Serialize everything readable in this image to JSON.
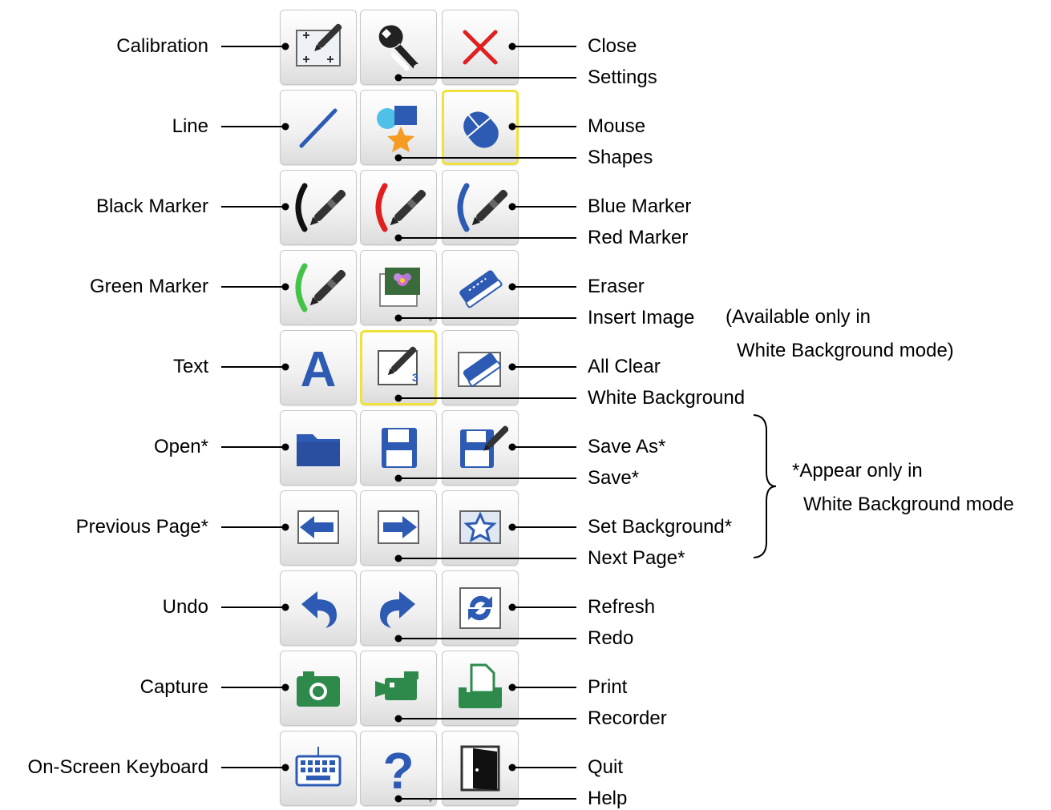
{
  "left_labels": [
    "Calibration",
    "Line",
    "Black Marker",
    "Green Marker",
    "Text",
    "Open*",
    "Previous Page*",
    "Undo",
    "Capture",
    "On-Screen Keyboard"
  ],
  "right_labels": [
    [
      "Close",
      "Settings"
    ],
    [
      "Mouse",
      "Shapes"
    ],
    [
      "Blue Marker",
      "Red Marker"
    ],
    [
      "Eraser",
      "Insert Image"
    ],
    [
      "All Clear",
      "White Background"
    ],
    [
      "Save As*",
      "Save*"
    ],
    [
      "Set Background*",
      "Next Page*"
    ],
    [
      "Refresh",
      "Redo"
    ],
    [
      "Print",
      "Recorder"
    ],
    [
      "Quit",
      "Help"
    ]
  ],
  "grid": [
    [
      {
        "icon": "calibration-icon"
      },
      {
        "icon": "wrench-icon"
      },
      {
        "icon": "close-x-icon"
      }
    ],
    [
      {
        "icon": "line-icon"
      },
      {
        "icon": "shapes-icon"
      },
      {
        "icon": "mouse-icon",
        "selected": true
      }
    ],
    [
      {
        "icon": "black-marker-icon"
      },
      {
        "icon": "red-marker-icon"
      },
      {
        "icon": "blue-marker-icon"
      }
    ],
    [
      {
        "icon": "green-marker-icon"
      },
      {
        "icon": "insert-image-icon",
        "dropdown": true
      },
      {
        "icon": "eraser-icon"
      }
    ],
    [
      {
        "icon": "text-a-icon"
      },
      {
        "icon": "white-background-icon",
        "selected": true,
        "badge": "3"
      },
      {
        "icon": "all-clear-icon"
      }
    ],
    [
      {
        "icon": "folder-icon"
      },
      {
        "icon": "floppy-save-icon"
      },
      {
        "icon": "floppy-save-as-icon"
      }
    ],
    [
      {
        "icon": "arrow-left-icon"
      },
      {
        "icon": "arrow-right-icon"
      },
      {
        "icon": "star-background-icon"
      }
    ],
    [
      {
        "icon": "undo-icon"
      },
      {
        "icon": "redo-icon"
      },
      {
        "icon": "refresh-icon"
      }
    ],
    [
      {
        "icon": "camera-icon"
      },
      {
        "icon": "video-camera-icon"
      },
      {
        "icon": "print-icon"
      }
    ],
    [
      {
        "icon": "keyboard-icon"
      },
      {
        "icon": "question-mark-icon",
        "dropdown": true
      },
      {
        "icon": "door-quit-icon"
      }
    ]
  ],
  "notes": {
    "insert_image_line1": "(Available only in",
    "insert_image_line2": "White Background mode)",
    "white_mode_line1": "*Appear only in",
    "white_mode_line2": "White Background mode"
  },
  "colors": {
    "blue": "#2d5bb4",
    "red": "#e02020",
    "black": "#111111",
    "green": "#2e8a4a",
    "green_marker": "#45c248",
    "orange": "#f59a23",
    "cyan": "#4fc1e9",
    "selected_border": "#f0e23a"
  }
}
